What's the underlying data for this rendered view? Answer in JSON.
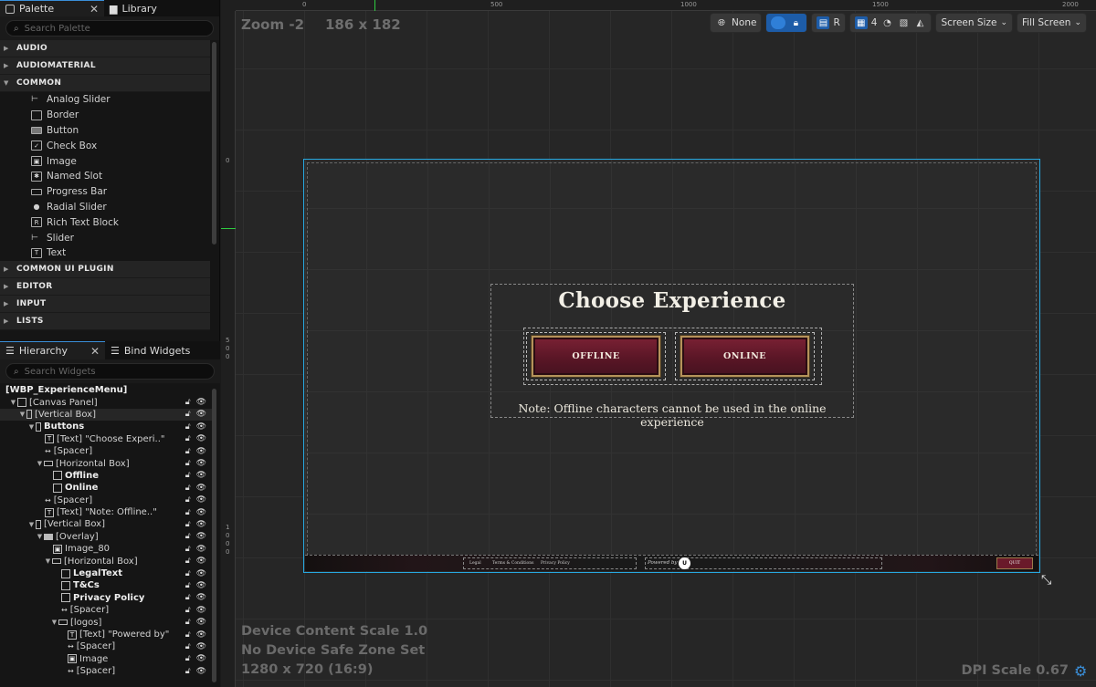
{
  "palette": {
    "tabs": [
      {
        "label": "Palette"
      },
      {
        "label": "Library"
      }
    ],
    "search_placeholder": "Search Palette",
    "categories_top": [
      {
        "label": "AUDIO"
      },
      {
        "label": "AUDIOMATERIAL"
      },
      {
        "label": "COMMON"
      }
    ],
    "common_items": [
      {
        "label": "Analog Slider",
        "icon": "slider-icon"
      },
      {
        "label": "Border",
        "icon": "border-icon"
      },
      {
        "label": "Button",
        "icon": "button-icon"
      },
      {
        "label": "Check Box",
        "icon": "checkbox-icon"
      },
      {
        "label": "Image",
        "icon": "image-icon"
      },
      {
        "label": "Named Slot",
        "icon": "named-slot-icon"
      },
      {
        "label": "Progress Bar",
        "icon": "progress-bar-icon"
      },
      {
        "label": "Radial Slider",
        "icon": "radial-slider-icon"
      },
      {
        "label": "Rich Text Block",
        "icon": "rich-text-icon"
      },
      {
        "label": "Slider",
        "icon": "slider-icon"
      },
      {
        "label": "Text",
        "icon": "text-icon"
      }
    ],
    "categories_bottom": [
      {
        "label": "COMMON UI PLUGIN"
      },
      {
        "label": "EDITOR"
      },
      {
        "label": "INPUT"
      },
      {
        "label": "LISTS"
      }
    ]
  },
  "hierarchy": {
    "tabs": [
      {
        "label": "Hierarchy"
      },
      {
        "label": "Bind Widgets"
      }
    ],
    "search_placeholder": "Search Widgets",
    "rows": [
      {
        "label": "[WBP_ExperienceMenu]"
      },
      {
        "label": "[Canvas Panel]"
      },
      {
        "label": "[Vertical Box]"
      },
      {
        "label": "Buttons"
      },
      {
        "label": "[Text] \"Choose Experi..\""
      },
      {
        "label": "[Spacer]"
      },
      {
        "label": "[Horizontal Box]"
      },
      {
        "label": "Offline"
      },
      {
        "label": "Online"
      },
      {
        "label": "[Spacer]"
      },
      {
        "label": "[Text] \"Note: Offline..\""
      },
      {
        "label": "[Vertical Box]"
      },
      {
        "label": "[Overlay]"
      },
      {
        "label": "Image_80"
      },
      {
        "label": "[Horizontal Box]"
      },
      {
        "label": "LegalText"
      },
      {
        "label": "T&Cs"
      },
      {
        "label": "Privacy Policy"
      },
      {
        "label": "[Spacer]"
      },
      {
        "label": "[logos]"
      },
      {
        "label": "[Text] \"Powered by\""
      },
      {
        "label": "[Spacer]"
      },
      {
        "label": "Image"
      },
      {
        "label": "[Spacer]"
      }
    ]
  },
  "designer": {
    "zoom": "Zoom -2",
    "size": "186 x 182",
    "ruler_top": [
      "0",
      "500",
      "1000",
      "1500",
      "2000"
    ],
    "ruler_left": [
      "0",
      "5",
      "0",
      "0",
      "1",
      "0",
      "0",
      "0"
    ],
    "toolbar": {
      "none_label": "None",
      "r_label": "R",
      "grid_value": "4",
      "screen_size_label": "Screen Size",
      "fill_screen_label": "Fill Screen"
    },
    "device_content_scale": "Device Content Scale 1.0",
    "safe_zone": "No Device Safe Zone Set",
    "resolution": "1280 x 720 (16:9)",
    "dpi_scale": "DPI Scale 0.67"
  },
  "widget": {
    "title": "Choose Experience",
    "offline_label": "OFFLINE",
    "online_label": "ONLINE",
    "note": "Note: Offline characters cannot be used in the online experience",
    "footer": {
      "legal": "Legal",
      "terms": "Terms & Conditions",
      "privacy": "Privacy Policy",
      "powered_by": "Powered by",
      "quit": "QUIT"
    }
  }
}
